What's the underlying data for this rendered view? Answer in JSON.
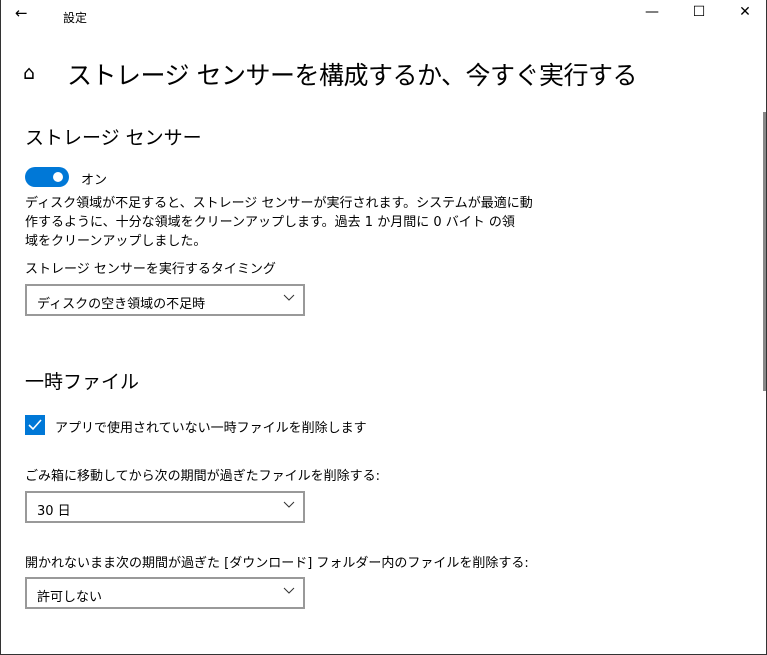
{
  "window": {
    "title": "設定",
    "minimize": "—",
    "maximize": "☐",
    "close": "✕",
    "back": "←"
  },
  "page_title": "ストレージ センサーを構成するか、今すぐ実行する",
  "storage_sense": {
    "heading": "ストレージ センサー",
    "toggle_label": "オン",
    "toggle_on": true,
    "desc_lines": [
      "ディスク領域が不足すると、ストレージ センサーが実行されます。システムが最適に動",
      "作するように、十分な領域をクリーンアップします。過去 1 か月間に 0 バイト の領",
      "域をクリーンアップしました。"
    ],
    "timing_label": "ストレージ センサーを実行するタイミング",
    "timing_value": "ディスクの空き領域の不足時"
  },
  "temp_files": {
    "heading": "一時ファイル",
    "checkbox_label": "アプリで使用されていない一時ファイルを削除します",
    "checkbox_checked": true,
    "recycle_label": "ごみ箱に移動してから次の期間が過ぎたファイルを削除する:",
    "recycle_value": "30 日",
    "downloads_label": "開かれないまま次の期間が過ぎた [ダウンロード] フォルダー内のファイルを削除する:",
    "downloads_value": "許可しない"
  },
  "colors": {
    "accent": "#0078d7"
  }
}
